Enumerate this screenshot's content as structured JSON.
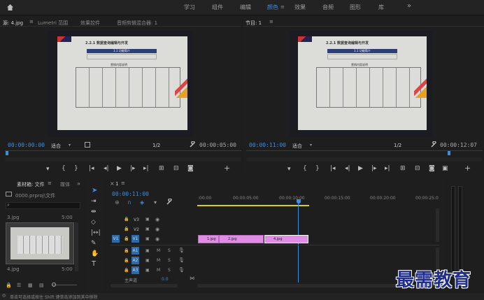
{
  "workspaces": [
    "学习",
    "组件",
    "编辑",
    "颜色",
    "效果",
    "音频",
    "图形",
    "库"
  ],
  "workspace_active": "颜色",
  "more_icon": "»",
  "source_monitor": {
    "tabs": [
      "源: 4.jpg",
      "Lumetri 范围",
      "效果控件",
      "音频剪辑混合器: 1"
    ],
    "timecode": "00:00:00:00",
    "fit": "适合",
    "quality": "1/2",
    "duration": "00:00:05:00"
  },
  "program_monitor": {
    "title": "节目: 1",
    "timecode": "00:00:11:00",
    "fit": "适合",
    "quality": "1/2",
    "duration": "00:00:12:07"
  },
  "slide": {
    "heading": "2.2.1 数据查询编辑与开发",
    "box_title": "1.1 功能简介",
    "sub_title": "营销内容说明"
  },
  "project": {
    "tab": "素材箱: 文件",
    "tab2": "媒体",
    "path": "0000.prproj\\文件",
    "item1_name": "3.jpg",
    "item1_dur": "5:00",
    "item2_name": "4.jpg",
    "item2_dur": "5:00"
  },
  "timeline": {
    "tab": "1",
    "timecode": "00:00:11:00",
    "ruler": [
      ":00:00",
      "00:00:05:00",
      "00:00:10:00",
      "00:00:15:00",
      "00:00:20:00",
      "00:00:25:0"
    ],
    "video_tracks": [
      "V3",
      "V2",
      "V1"
    ],
    "audio_tracks": [
      "A1",
      "A2",
      "A3"
    ],
    "source_patch": "V1",
    "master": "主声道",
    "master_val": "0.0",
    "clips": [
      "1.jpg",
      "2.jpg",
      "4.jpg"
    ],
    "m_label": "M",
    "s_label": "S"
  },
  "status": "单击可选择或按住 Shift 键单击添加到其中移除",
  "watermark": "最需教育"
}
